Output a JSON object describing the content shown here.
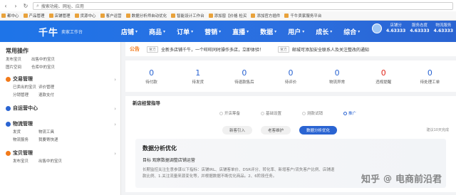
{
  "browser": {
    "address": "搜索功能、网址、应用"
  },
  "bookmarks": [
    "都中心",
    "产品管理",
    "店铺管理",
    "货源中心",
    "客户运营",
    "数据分析师自动优化",
    "智能设计工作台",
    "添加窗【价格 检买",
    "添加官方插件"
  ],
  "bookmark_right": "千牛卖家服务平台",
  "header": {
    "brand": "千牛",
    "subtitle": "卖家工作台",
    "nav": [
      "店铺",
      "商品",
      "订单",
      "营销",
      "直播",
      "数据",
      "用户",
      "成长",
      "综合"
    ],
    "stats": [
      {
        "label": "店铺分",
        "value": "4.63333"
      },
      {
        "label": "服务态度",
        "value": "4.63333"
      },
      {
        "label": "物流服务",
        "value": "4.63333"
      }
    ]
  },
  "sidebar": {
    "common_title": "常用操作",
    "common_links": [
      "发布宝贝",
      "出售中的宝贝",
      "图片空间",
      "仓库中的宝贝"
    ],
    "groups": [
      {
        "title": "交易管理",
        "color": "#f27a1a",
        "links": [
          "已卖出的宝贝",
          "评价管理",
          "分销管理",
          "退款支付"
        ]
      },
      {
        "title": "自运营中心",
        "color": "#2a64d2",
        "links": []
      },
      {
        "title": "物流管理",
        "color": "#2a64d2",
        "links": [
          "发货",
          "物流工具",
          "物流服务",
          "我要寄快递"
        ]
      },
      {
        "title": "宝贝管理",
        "color": "#f27a1a",
        "links": [
          "发布宝贝",
          "出售中的宝贝"
        ]
      }
    ]
  },
  "notice": {
    "label": "公告",
    "badge1": "官方",
    "text1": "全新多店铺千牛，一个旺旺同时操作多店，立即体验！",
    "badge2": "官方",
    "text2": "邮城可添加安全联系人及关注整改的通知"
  },
  "stats": [
    {
      "value": "0",
      "label": "待付款",
      "red": false
    },
    {
      "value": "1",
      "label": "待发货",
      "red": false
    },
    {
      "value": "0",
      "label": "待退款售后",
      "red": false
    },
    {
      "value": "0",
      "label": "待评价",
      "red": false
    },
    {
      "value": "0",
      "label": "物流异常",
      "red": false
    },
    {
      "value": "0",
      "label": "违规提醒",
      "red": true
    },
    {
      "value": "0",
      "label": "待处理工单",
      "red": false
    }
  ],
  "guide": {
    "title": "新店经营指导",
    "steps": [
      "开店筹备",
      "基础设置",
      "测款试销",
      "推广"
    ],
    "tabs": [
      "新客引入",
      "老客维护",
      "数据分析优化"
    ],
    "tab_hint": "建议10天完成",
    "analysis_title": "数据分析优化",
    "analysis_goal": "目标 观察数据调整店铺运营",
    "analysis_desc": "长期监控关注生意参谋以下指标：店铺IRL、店铺客单价、DSR评分、转化率、新增客户/流失客户比例、店铺退款比例、1.关注流量来源变化等，并根据数据不断优化商品。2、6阶段任务。"
  },
  "watermark": {
    "site": "知乎",
    "at": "@",
    "author": "电商前沿君"
  }
}
